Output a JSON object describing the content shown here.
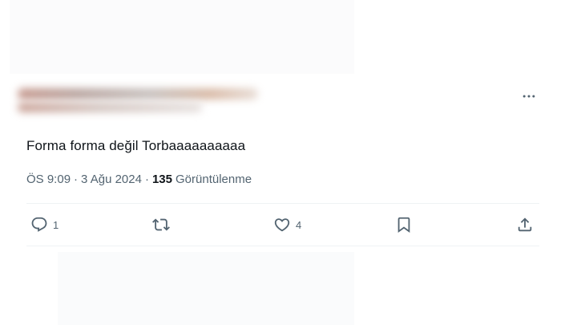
{
  "tweet": {
    "text": "Forma forma değil Torbaaaaaaaaaa",
    "time": "ÖS 9:09",
    "separator": "·",
    "date": "3 Ağu 2024",
    "views_count": "135",
    "views_label": "Görüntülenme"
  },
  "actions": {
    "reply_count": "1",
    "like_count": "4"
  },
  "icons": {
    "more": "more-horizontal-icon",
    "reply": "reply-icon",
    "retweet": "retweet-icon",
    "like": "heart-icon",
    "bookmark": "bookmark-icon",
    "share": "share-icon"
  },
  "colors": {
    "text_primary": "#0f1419",
    "text_secondary": "#536471",
    "divider": "#eff3f4"
  }
}
